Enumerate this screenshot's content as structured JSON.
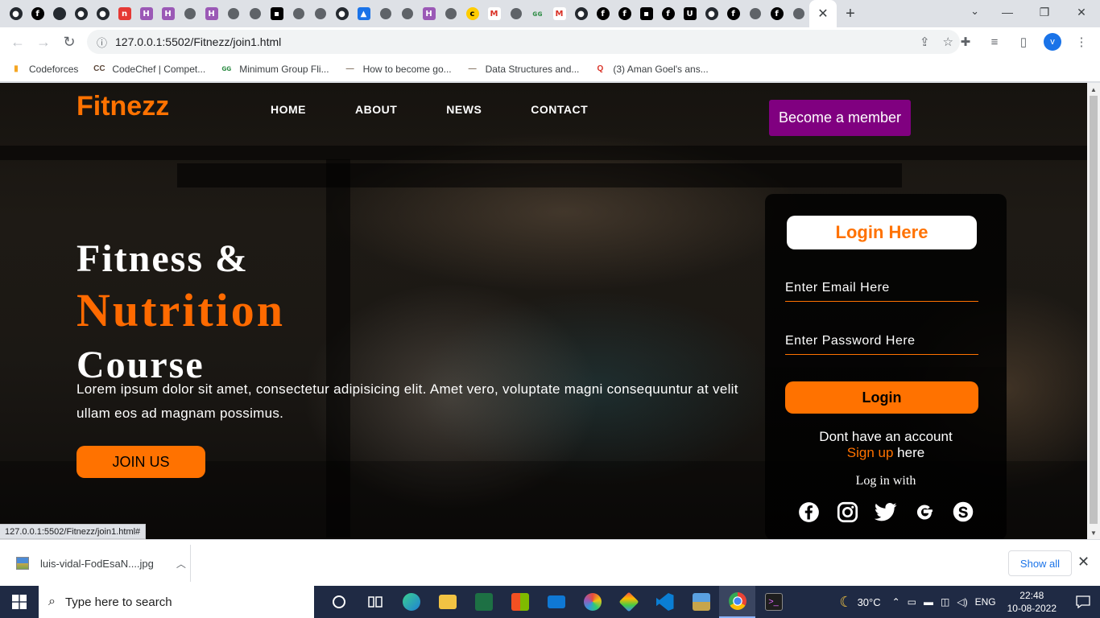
{
  "browser": {
    "tab_favicons": [
      "github",
      "cf",
      "gh",
      "github",
      "github",
      "red",
      "hk",
      "hk",
      "gray",
      "hk",
      "gray",
      "gray",
      "blk",
      "gray",
      "gray",
      "github",
      "blue",
      "gray",
      "gray",
      "hk",
      "gray",
      "yel",
      "gm",
      "gray",
      "gfg",
      "gm",
      "github",
      "cf",
      "cf",
      "blk",
      "cf",
      "u",
      "github",
      "cf",
      "gray",
      "cf",
      "gray"
    ],
    "tab_favicon_letters": {
      "cf": "f",
      "hk": "H",
      "red": "n",
      "u": "U",
      "yel": "c",
      "gm": "M",
      "gfg": "ɢɢ",
      "blk": "▪",
      "blue": "▲"
    },
    "active_tab_close": "✕",
    "new_tab": "+",
    "url": "127.0.0.1:5502/Fitnezz/join1.html",
    "profile_initial": "v",
    "bookmarks": [
      {
        "icon": "bars-icon",
        "label": "Codeforces"
      },
      {
        "icon": "codechef-icon",
        "label": "CodeChef | Compet..."
      },
      {
        "icon": "gfg-icon",
        "label": "Minimum Group Fli..."
      },
      {
        "icon": "dash-icon",
        "label": "How to become go..."
      },
      {
        "icon": "dash-icon",
        "label": "Data Structures and..."
      },
      {
        "icon": "quora-icon",
        "label": "(3) Aman Goel's ans..."
      }
    ]
  },
  "page": {
    "logo": "Fitnezz",
    "nav": [
      "HOME",
      "ABOUT",
      "NEWS",
      "CONTACT"
    ],
    "member_button": "Become a member",
    "hero": {
      "line1": "Fitness &",
      "line2": "Nutrition",
      "line3": "Course"
    },
    "paragraph": "Lorem ipsum dolor sit amet, consectetur adipisicing elit. Amet vero, voluptate magni consequuntur at velit ullam eos ad magnam possimus.",
    "join_button": "JOIN US",
    "login": {
      "title": "Login Here",
      "email_placeholder": "Enter Email Here",
      "password_placeholder": "Enter Password Here",
      "button": "Login",
      "no_account": "Dont have an account",
      "signup_link": "Sign up",
      "signup_suffix": " here",
      "log_in_with": "Log in with",
      "socials": [
        "facebook",
        "instagram",
        "twitter",
        "google",
        "skype"
      ]
    },
    "status_url": "127.0.0.1:5502/Fitnezz/join1.html#"
  },
  "download_bar": {
    "filename": "luis-vidal-FodEsaN....jpg",
    "show_all": "Show all"
  },
  "taskbar": {
    "search_placeholder": "Type here to search",
    "temperature": "30°C",
    "language": "ENG",
    "time": "22:48",
    "date": "10-08-2022"
  },
  "colors": {
    "accent": "#ff7200",
    "member": "#800080"
  }
}
